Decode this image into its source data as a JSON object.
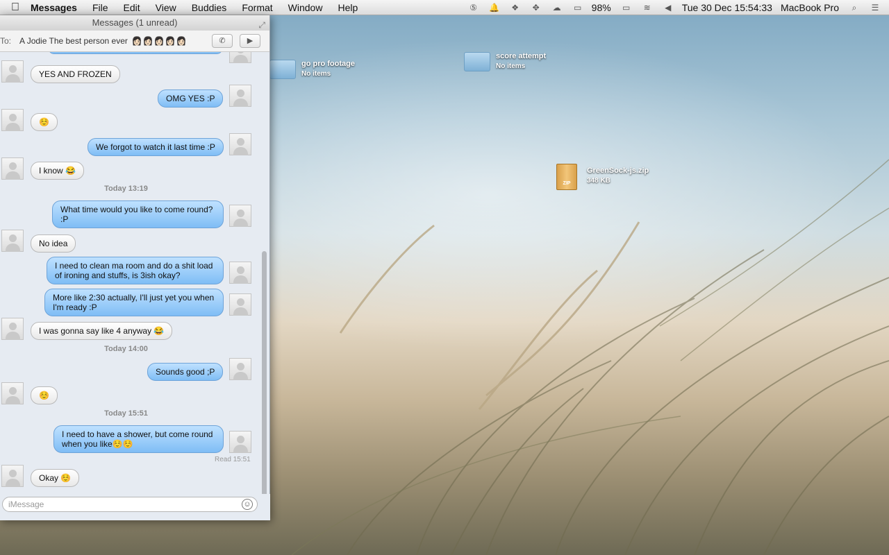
{
  "menubar": {
    "app": "Messages",
    "items": [
      "File",
      "Edit",
      "View",
      "Buddies",
      "Format",
      "Window",
      "Help"
    ],
    "battery": "98%",
    "datetime": "Tue 30 Dec  15:54:33",
    "computer_name": "MacBook Pro"
  },
  "desktop": {
    "items": [
      {
        "name": "go pro footage",
        "sub": "No items"
      },
      {
        "name": "score attempt",
        "sub": "No items"
      },
      {
        "name": "GreenSock-js.zip",
        "sub": "348 KB",
        "badge": "ZIP"
      }
    ]
  },
  "window": {
    "title": "Messages (1 unread)",
    "to_label": "To:",
    "to_name": "A Jodie The best person ever",
    "to_emoji": "👩🏻👩🏻👩🏻👩🏻👩🏻"
  },
  "messages": [
    {
      "from": "them",
      "text": "YES AND FROZEN"
    },
    {
      "from": "me",
      "text": "OMG YES :P"
    },
    {
      "from": "them",
      "text": "☺️"
    },
    {
      "from": "me",
      "text": "We forgot to watch it last time :P"
    },
    {
      "from": "them",
      "text": "I know 😂"
    },
    {
      "from": "stamp",
      "text": "Today 13:19"
    },
    {
      "from": "me",
      "text": "What time would you like to come round? :P"
    },
    {
      "from": "them",
      "text": "No idea"
    },
    {
      "from": "me",
      "text": "I need to clean ma room and do a shit load of ironing and stuffs, is 3ish okay?"
    },
    {
      "from": "me",
      "text": "More like 2:30 actually, I'll just yet you when I'm ready :P"
    },
    {
      "from": "them",
      "text": "I was gonna say like 4 anyway 😂"
    },
    {
      "from": "stamp",
      "text": "Today 14:00"
    },
    {
      "from": "me",
      "text": "Sounds good ;P"
    },
    {
      "from": "them",
      "text": "☺️"
    },
    {
      "from": "stamp",
      "text": "Today 15:51"
    },
    {
      "from": "me",
      "text": "I need to have a shower, but come round when you like☺️☺️"
    },
    {
      "from": "them",
      "text": "Okay ☺️"
    }
  ],
  "read_receipt": {
    "label": "Read",
    "time": "15:51"
  },
  "input": {
    "placeholder": "iMessage"
  },
  "icons": {
    "apple": "apple-icon",
    "search": "search-icon",
    "list": "list-icon",
    "phone": "phone-icon",
    "video": "video-icon",
    "smiley": "smiley-icon"
  }
}
